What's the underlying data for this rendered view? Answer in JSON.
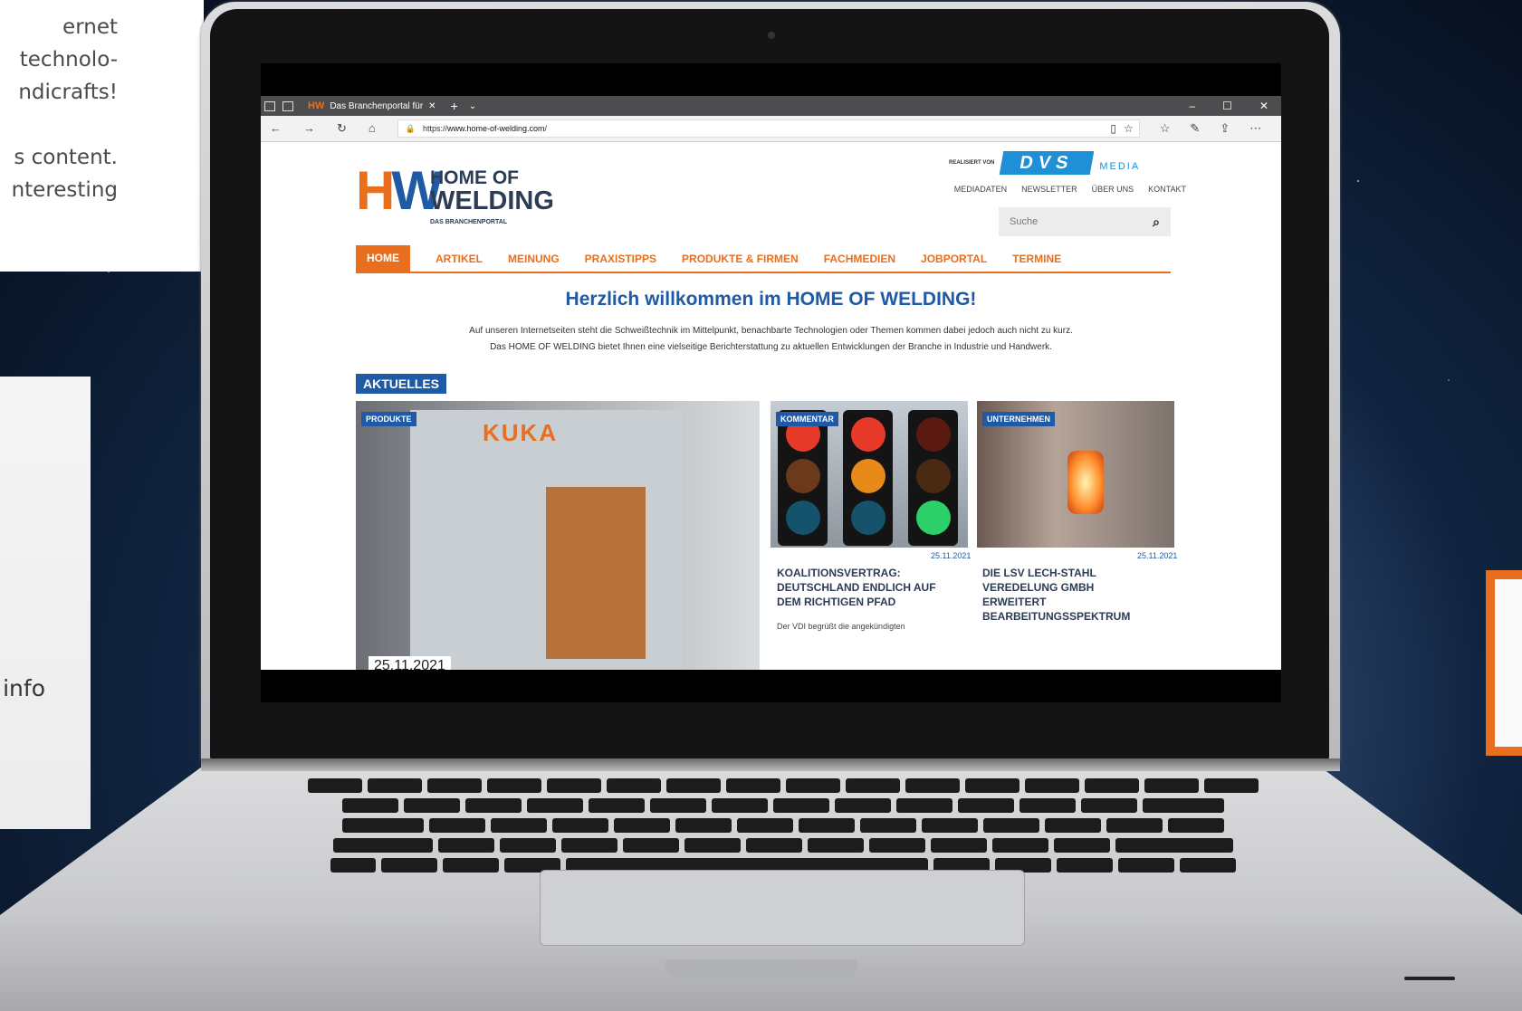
{
  "left_text": {
    "lines": [
      "ernet",
      "technolo-",
      "ndicrafts!",
      "s content.",
      "nteresting"
    ],
    "info_label": "info"
  },
  "browser": {
    "tab_title": "Das Branchenportal für",
    "tab_favicon": "HW",
    "url_prefix": "https://",
    "url_domain": "www.home-of-welding.com",
    "url_suffix": "/"
  },
  "site": {
    "logo_letters": [
      "H",
      "W"
    ],
    "logo_line1": "HOME OF",
    "logo_line2": "WELDING",
    "logo_line3": "DAS BRANCHENPORTAL",
    "realisiert": "REALISIERT VON",
    "dvs_mark": "DVS",
    "dvs_media": "MEDIA",
    "top_links": [
      "MEDIADATEN",
      "NEWSLETTER",
      "ÜBER UNS",
      "KONTAKT"
    ],
    "search_placeholder": "Suche",
    "nav": [
      "HOME",
      "ARTIKEL",
      "MEINUNG",
      "PRAXISTIPPS",
      "PRODUKTE & FIRMEN",
      "FACHMEDIEN",
      "JOBPORTAL",
      "TERMINE"
    ],
    "welcome": "Herzlich willkommen im HOME OF WELDING!",
    "intro_line1": "Auf unseren Internetseiten steht die Schweißtechnik im Mittelpunkt, benachbarte Technologien oder Themen kommen dabei jedoch auch nicht zu kurz.",
    "intro_line2": "Das HOME OF WELDING bietet Ihnen eine vielseitige Berichterstattung zu aktuellen Entwicklungen der Branche in Industrie und Handwerk.",
    "section": "AKTUELLES",
    "cards": [
      {
        "tag": "PRODUKTE",
        "brand": "KUKA",
        "date": "25.11.2021"
      },
      {
        "tag": "KOMMENTAR",
        "date": "25.11.2021",
        "title_lines": [
          "KOALITIONSVERTRAG:",
          "DEUTSCHLAND ENDLICH AUF",
          "DEM RICHTIGEN PFAD"
        ],
        "teaser": "Der VDI begrüßt die angekündigten"
      },
      {
        "tag": "UNTERNEHMEN",
        "date": "25.11.2021",
        "title_lines": [
          "DIE LSV LECH-STAHL",
          "VEREDELUNG GMBH",
          "ERWEITERT",
          "BEARBEITUNGSSPEKTRUM"
        ]
      }
    ]
  },
  "colors": {
    "orange": "#e96f1e",
    "blue": "#1f5aa6",
    "dvs": "#1f8fd6"
  }
}
